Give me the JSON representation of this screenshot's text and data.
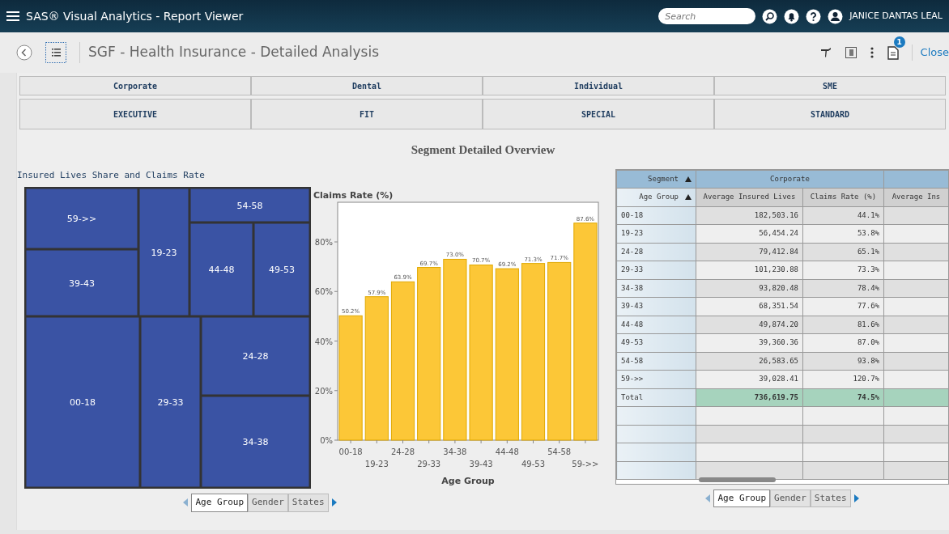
{
  "app_bar": {
    "title": "SAS® Visual Analytics - Report Viewer",
    "search": {
      "placeholder": "Search"
    },
    "user": "JANICE DANTAS LEAL"
  },
  "report_bar": {
    "title": "SGF - Health Insurance - Detailed Analysis",
    "notification_count": "1",
    "close": "Close"
  },
  "button_rows": [
    [
      "Corporate",
      "Dental",
      "Individual",
      "SME"
    ],
    [
      "EXECUTIVE",
      "FIT",
      "SPECIAL",
      "STANDARD"
    ]
  ],
  "section_title": "Segment Detailed Overview",
  "treemap": {
    "title": "Insured Lives Share and Claims Rate",
    "tiles": [
      "59->>",
      "19-23",
      "54-58",
      "44-48",
      "49-53",
      "39-43",
      "00-18",
      "29-33",
      "24-28",
      "34-38"
    ]
  },
  "bar_chart": {
    "chart_data": {
      "type": "bar",
      "title": "Claims Rate (%)",
      "xlabel": "Age Group",
      "categories": [
        "00-18",
        "19-23",
        "24-28",
        "29-33",
        "34-38",
        "39-43",
        "44-48",
        "49-53",
        "54-58",
        "59->>"
      ],
      "values": [
        50.2,
        57.9,
        63.9,
        69.7,
        73.0,
        70.7,
        69.2,
        71.3,
        71.7,
        87.6
      ],
      "ylim": [
        0,
        96
      ],
      "yticks": [
        {
          "value": 0,
          "label": "0%"
        },
        {
          "value": 20,
          "label": "20%"
        },
        {
          "value": 40,
          "label": "40%"
        },
        {
          "value": 60,
          "label": "60%"
        },
        {
          "value": 80,
          "label": "80%"
        }
      ],
      "value_labels": [
        "50.2%",
        "57.9%",
        "63.9%",
        "69.7%",
        "73.0%",
        "70.7%",
        "69.2%",
        "71.3%",
        "71.7%",
        "87.6%"
      ]
    }
  },
  "left_tabs": [
    {
      "label": "Age Group",
      "selected": true
    },
    {
      "label": "Gender",
      "selected": false
    },
    {
      "label": "States",
      "selected": false
    }
  ],
  "table": {
    "corner": [
      "Segment",
      "Age Group"
    ],
    "group": "Corporate",
    "columns": [
      "Average Insured Lives",
      "Claims Rate (%)",
      "Average Ins"
    ],
    "rows": [
      {
        "kind": "data",
        "label": "00-18",
        "cells": [
          "182,503.16",
          "44.1%"
        ]
      },
      {
        "kind": "data",
        "label": "19-23",
        "cells": [
          "56,454.24",
          "53.8%"
        ]
      },
      {
        "kind": "data",
        "label": "24-28",
        "cells": [
          "79,412.84",
          "65.1%"
        ]
      },
      {
        "kind": "data",
        "label": "29-33",
        "cells": [
          "101,230.88",
          "73.3%"
        ]
      },
      {
        "kind": "data",
        "label": "34-38",
        "cells": [
          "93,820.48",
          "78.4%"
        ]
      },
      {
        "kind": "data",
        "label": "39-43",
        "cells": [
          "68,351.54",
          "77.6%"
        ]
      },
      {
        "kind": "data",
        "label": "44-48",
        "cells": [
          "49,874.20",
          "81.6%"
        ]
      },
      {
        "kind": "data",
        "label": "49-53",
        "cells": [
          "39,360.36",
          "87.0%"
        ]
      },
      {
        "kind": "data",
        "label": "54-58",
        "cells": [
          "26,583.65",
          "93.8%"
        ]
      },
      {
        "kind": "data",
        "label": "59->>",
        "cells": [
          "39,028.41",
          "120.7%"
        ]
      },
      {
        "kind": "total",
        "label": "Total",
        "cells": [
          "736,619.75",
          "74.5%"
        ]
      }
    ]
  },
  "right_tabs": [
    {
      "label": "Age Group",
      "selected": true
    },
    {
      "label": "Gender",
      "selected": false
    },
    {
      "label": "States",
      "selected": false
    }
  ]
}
